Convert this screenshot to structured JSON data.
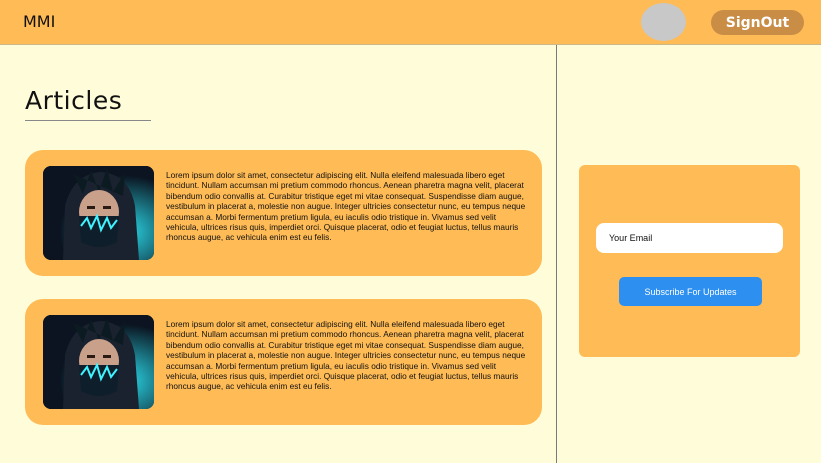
{
  "header": {
    "brand": "MMI",
    "signout_label": "SignOut",
    "avatar_color": "#c8c8c8"
  },
  "main": {
    "title": "Articles",
    "articles": [
      {
        "image_icon": "masked-character-image",
        "body": "Lorem ipsum dolor sit amet, consectetur adipiscing elit. Nulla eleifend malesuada libero eget tincidunt. Nullam accumsan mi pretium commodo rhoncus. Aenean pharetra magna velit, placerat bibendum odio convallis at. Curabitur tristique eget mi vitae consequat. Suspendisse diam augue, vestibulum in placerat a, molestie non augue. Integer ultricies consectetur nunc, eu tempus neque accumsan a. Morbi fermentum pretium ligula, eu iaculis odio tristique in. Vivamus sed velit vehicula, ultrices risus quis, imperdiet orci. Quisque placerat, odio et feugiat luctus, tellus mauris rhoncus augue, ac vehicula enim est eu felis."
      },
      {
        "image_icon": "masked-character-image",
        "body": "Lorem ipsum dolor sit amet, consectetur adipiscing elit. Nulla eleifend malesuada libero eget tincidunt. Nullam accumsan mi pretium commodo rhoncus. Aenean pharetra magna velit, placerat bibendum odio convallis at. Curabitur tristique eget mi vitae consequat. Suspendisse diam augue, vestibulum in placerat a, molestie non augue. Integer ultricies consectetur nunc, eu tempus neque accumsan a. Morbi fermentum pretium ligula, eu iaculis odio tristique in. Vivamus sed velit vehicula, ultrices risus quis, imperdiet orci. Quisque placerat, odio et feugiat luctus, tellus mauris rhoncus augue, ac vehicula enim est eu felis."
      }
    ]
  },
  "sidebar": {
    "email_placeholder": "Your Email",
    "email_value": "",
    "subscribe_label": "Subscribe For Updates"
  },
  "colors": {
    "accent": "#ffbb55",
    "background": "#fffdd9",
    "signout": "#c98d46",
    "primary_button": "#2d8ff0"
  }
}
